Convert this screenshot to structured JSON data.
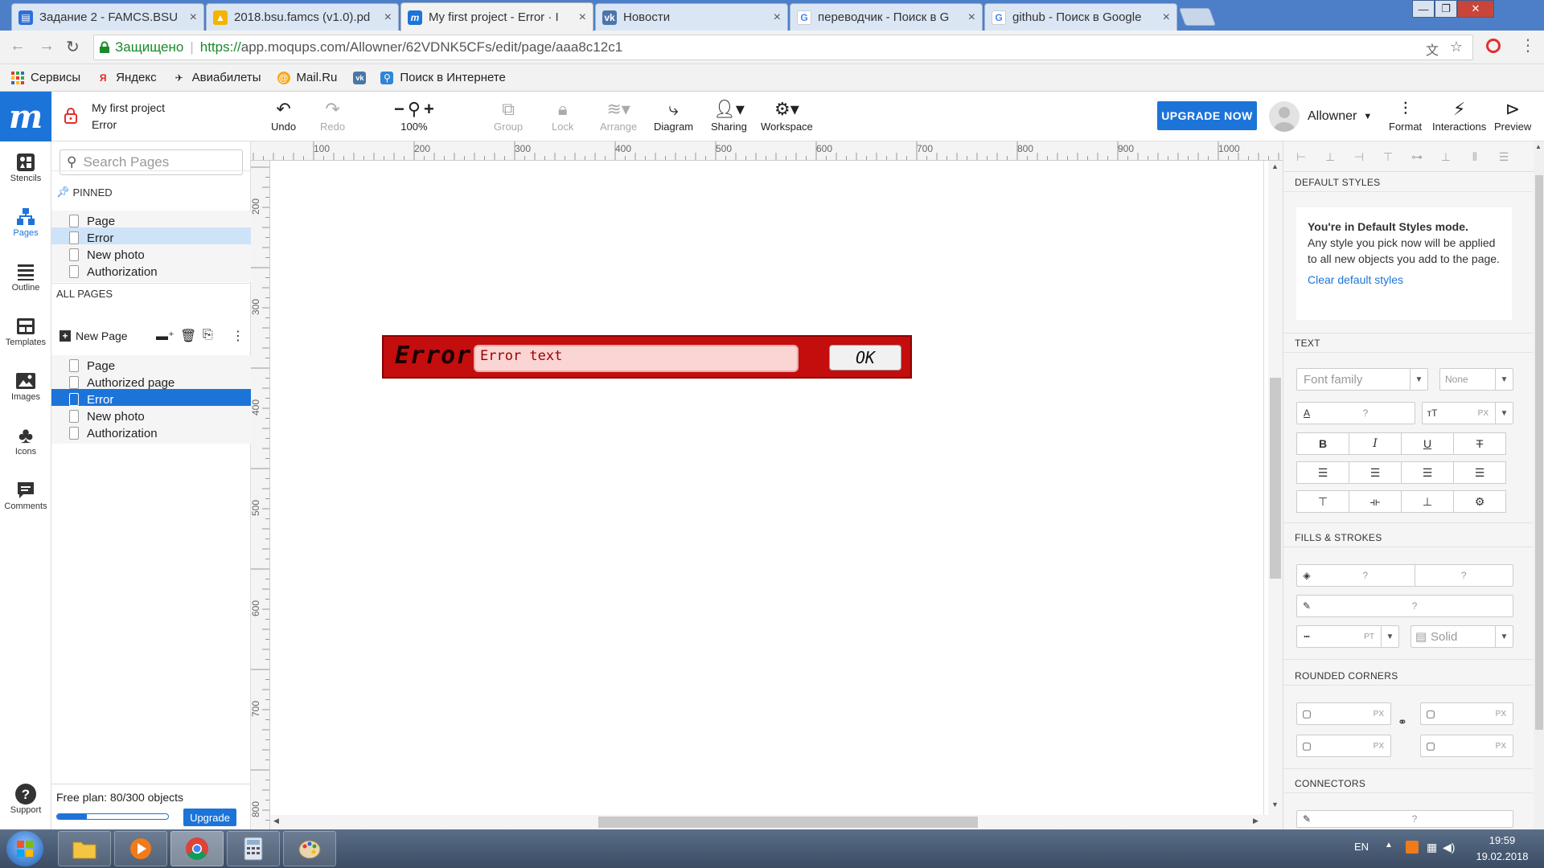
{
  "browser": {
    "tabs": [
      {
        "title": "Задание 2 - FAMCS.BSU",
        "icon": "doc-icon",
        "color": "#2f6fd6"
      },
      {
        "title": "2018.bsu.famcs (v1.0).pd",
        "icon": "drive-icon",
        "color": "#f4b400"
      },
      {
        "title": "My first project - Error · I",
        "icon": "moqups-icon",
        "color": "#1c74d9"
      },
      {
        "title": "Новости",
        "icon": "vk-icon",
        "color": "#4a76a8"
      },
      {
        "title": "переводчик - Поиск в G",
        "icon": "google-icon",
        "color": "#4285f4"
      },
      {
        "title": "github - Поиск в Google",
        "icon": "google-icon",
        "color": "#4285f4"
      }
    ],
    "secure_label": "Защищено",
    "url_scheme": "https://",
    "url_rest": "app.moqups.com/Allowner/62VDNK5CFs/edit/page/aaa8c12c1",
    "bookmarks": [
      "Сервисы",
      "Яндекс",
      "Авиабилеты",
      "Mail.Ru",
      "",
      "Поиск в Интернете"
    ]
  },
  "app": {
    "project_name": "My first project",
    "page_name": "Error",
    "toolbar": {
      "undo": "Undo",
      "redo": "Redo",
      "zoom": "100%",
      "group": "Group",
      "lock": "Lock",
      "arrange": "Arrange",
      "diagram": "Diagram",
      "sharing": "Sharing",
      "workspace": "Workspace"
    },
    "upgrade_now": "UPGRADE NOW",
    "user": "Allowner",
    "right_tools": {
      "format": "Format",
      "interactions": "Interactions",
      "preview": "Preview"
    }
  },
  "rail": [
    "Stencils",
    "Pages",
    "Outline",
    "Templates",
    "Images",
    "Icons",
    "Comments",
    "Support"
  ],
  "pages_panel": {
    "search_placeholder": "Search Pages",
    "pinned_header": "PINNED",
    "pinned": [
      "Page",
      "Error",
      "New photo",
      "Authorization"
    ],
    "all_header": "ALL PAGES",
    "new_page": "New Page",
    "all": [
      "Page",
      "Authorized page",
      "Error",
      "New photo",
      "Authorization"
    ],
    "free_plan": "Free plan: 80/300 objects",
    "usage_fraction": 0.267,
    "upgrade": "Upgrade"
  },
  "ruler": {
    "top": [
      "100",
      "200",
      "300",
      "400",
      "500",
      "600",
      "700",
      "800",
      "900",
      "1000"
    ],
    "left": [
      "200",
      "300",
      "400",
      "500",
      "600",
      "700",
      "800"
    ]
  },
  "canvas": {
    "error_title": "Error",
    "error_text": "Error text",
    "ok_label": "OK"
  },
  "props": {
    "default_styles_header": "DEFAULT STYLES",
    "default_title": "You're in Default Styles mode.",
    "default_body": "Any style you pick now will be applied to all new objects you add to the page.",
    "clear_link": "Clear default styles",
    "text_header": "TEXT",
    "font_family": "Font family",
    "font_none": "None",
    "q": "?",
    "px": "PX",
    "pt": "PT",
    "fills_header": "FILLS & STROKES",
    "solid": "Solid",
    "rounded_header": "ROUNDED CORNERS",
    "connectors_header": "CONNECTORS"
  },
  "taskbar": {
    "lang": "EN",
    "time": "19:59",
    "date": "19.02.2018"
  }
}
